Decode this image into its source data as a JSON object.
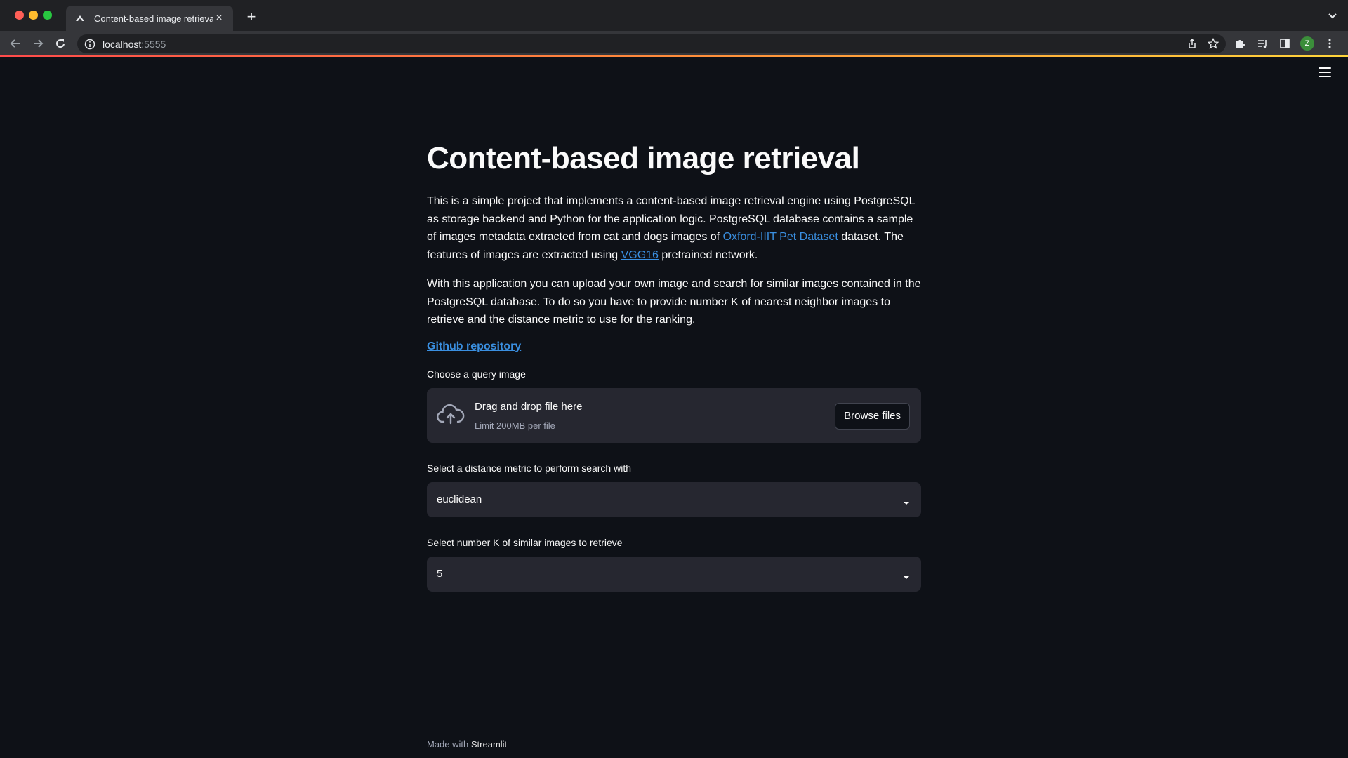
{
  "browser": {
    "tab_title": "Content-based image retrieval",
    "url_host": "localhost",
    "url_port": ":5555",
    "avatar_letter": "Z"
  },
  "app": {
    "title": "Content-based image retrieval",
    "intro": {
      "part1": "This is a simple project that implements a content-based image retrieval engine using PostgreSQL as storage backend and Python for the application logic. PostgreSQL database contains a sample of images metadata extracted from cat and dogs images of ",
      "link1": "Oxford-IIIT Pet Dataset",
      "part2": " dataset. The features of images are extracted using ",
      "link2": "VGG16",
      "part3": " pretrained network."
    },
    "usage": "With this application you can upload your own image and search for similar images contained in the PostgreSQL database. To do so you have to provide number K of nearest neighbor images to retrieve and the distance metric to use for the ranking.",
    "github_link": "Github repository",
    "uploader": {
      "label": "Choose a query image",
      "title": "Drag and drop file here",
      "limit": "Limit 200MB per file",
      "button": "Browse files"
    },
    "metric_select": {
      "label": "Select a distance metric to perform search with",
      "value": "euclidean"
    },
    "k_select": {
      "label": "Select number K of similar images to retrieve",
      "value": "5"
    },
    "footer": {
      "prefix": "Made with ",
      "brand": "Streamlit"
    }
  }
}
